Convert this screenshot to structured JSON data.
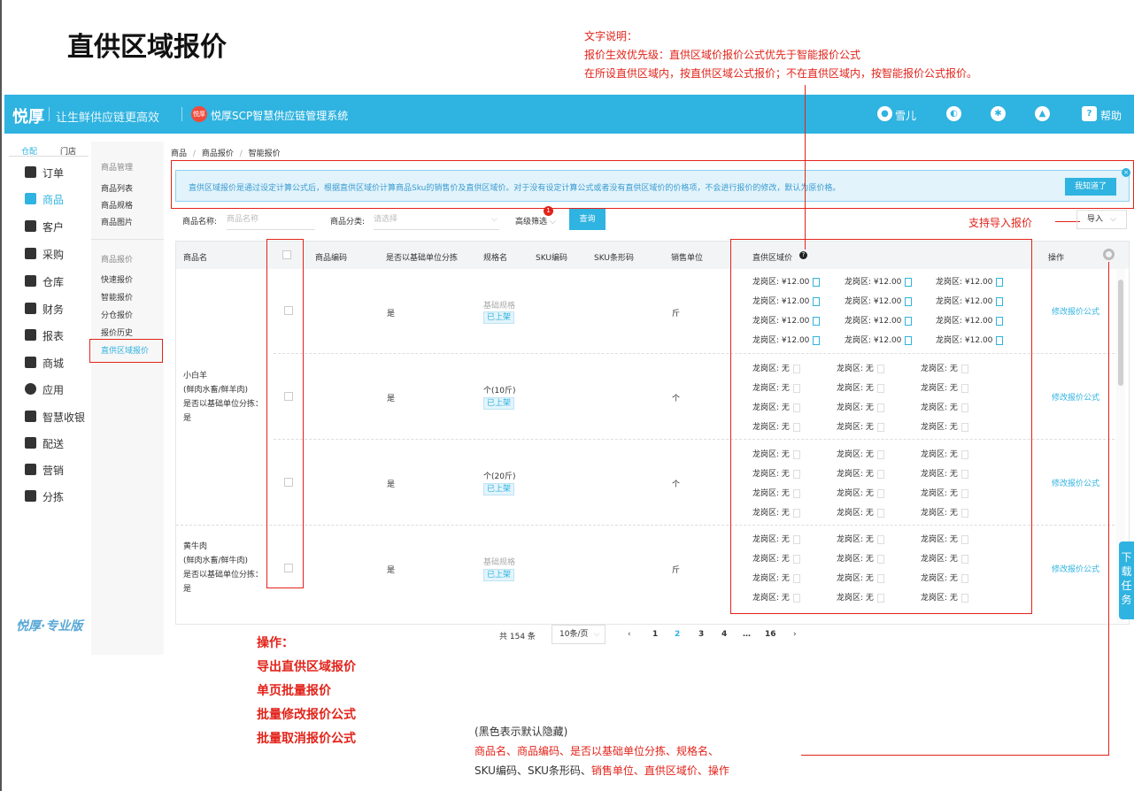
{
  "page_title": "直供区域报价",
  "notes": {
    "title": "文字说明：",
    "line1": "报价生效优先级：直供区域价报价公式优先于智能报价公式",
    "line2": "在所设直供区域内，按直供区域公式报价；不在直供区域内，按智能报价公式报价。",
    "import_note": "支持导入报价",
    "ops_title": "操作：",
    "ops": [
      "导出直供区域报价",
      "单页批量报价",
      "批量修改报价公式",
      "批量取消报价公式"
    ],
    "cols_line1": "(黑色表示默认隐藏)",
    "cols_line2": "商品名、商品编码、是否以基础单位分拣、规格名、",
    "cols_line3a": "SKU编码、SKU条形码、",
    "cols_line3b": "销售单位、直供区域价、操作"
  },
  "topbar": {
    "logo": "悦厚",
    "slogan": "让生鲜供应链更高效",
    "brand_icon": "悦厚",
    "brand_name": "悦厚SCP智慧供应链管理系统",
    "user": "雪儿",
    "help": "帮助"
  },
  "side_tabs": [
    "仓配",
    "门店"
  ],
  "menu": [
    {
      "label": "订单",
      "icon": "order-icon"
    },
    {
      "label": "商品",
      "icon": "goods-icon",
      "active": true
    },
    {
      "label": "客户",
      "icon": "customer-icon"
    },
    {
      "label": "采购",
      "icon": "purchase-icon"
    },
    {
      "label": "仓库",
      "icon": "warehouse-icon"
    },
    {
      "label": "财务",
      "icon": "finance-icon"
    },
    {
      "label": "报表",
      "icon": "report-icon"
    },
    {
      "label": "商城",
      "icon": "mall-icon"
    },
    {
      "label": "应用",
      "icon": "app-icon"
    },
    {
      "label": "智慧收银",
      "icon": "cashier-icon"
    },
    {
      "label": "配送",
      "icon": "delivery-icon"
    },
    {
      "label": "营销",
      "icon": "marketing-icon"
    },
    {
      "label": "分拣",
      "icon": "sorting-icon"
    }
  ],
  "footer_logo": "悦厚·专业版",
  "submenu": {
    "group1": "商品管理",
    "group1_items": [
      "商品列表",
      "商品规格",
      "商品图片"
    ],
    "group2": "商品报价",
    "group2_items": [
      "快速报价",
      "智能报价",
      "分仓报价",
      "报价历史",
      "直供区域报价"
    ]
  },
  "breadcrumb": [
    "商品",
    "/",
    "商品报价",
    "/",
    "智能报价"
  ],
  "alert": {
    "text": "直供区域报价是通过设定计算公式后，根据直供区域价计算商品Sku的销售价及直供区域价。对于没有设定计算公式或者没有直供区域价的价格项，不会进行报价的修改，默认为原价格。",
    "button": "我知道了",
    "close": "×"
  },
  "filters": {
    "name_label": "商品名称:",
    "name_placeholder": "商品名称",
    "category_label": "商品分类:",
    "category_placeholder": "请选择",
    "advanced": "高级筛选",
    "badge": "1",
    "query": "查询",
    "import": "导入"
  },
  "columns": [
    "商品名",
    "商品编码",
    "是否以基础单位分拣",
    "规格名",
    "SKU编码",
    "SKU条形码",
    "销售单位",
    "直供区域价",
    "操作"
  ],
  "products": [
    {
      "name": "小白羊",
      "category": "(鲜肉水畜/鲜羊肉)",
      "basic_label": "是否以基础单位分拣：",
      "basic_value": "是"
    },
    {
      "name": "黄牛肉",
      "category": "(鲜肉水畜/鲜牛肉)",
      "basic_label": "是否以基础单位分拣：",
      "basic_value": "是"
    }
  ],
  "rows": [
    {
      "basic": "是",
      "spec": "基础规格",
      "spec_grey": true,
      "tag": "已上架",
      "unit": "斤",
      "region": "龙岗区:",
      "price": "¥12.00",
      "op": "修改报价公式"
    },
    {
      "basic": "是",
      "spec": "个(10斤)",
      "spec_grey": false,
      "tag": "已上架",
      "unit": "个",
      "region": "龙岗区:",
      "price": "无",
      "op": "修改报价公式"
    },
    {
      "basic": "是",
      "spec": "个(20斤)",
      "spec_grey": false,
      "tag": "已上架",
      "unit": "个",
      "region": "龙岗区:",
      "price": "无",
      "op": "修改报价公式"
    },
    {
      "basic": "是",
      "spec": "基础规格",
      "spec_grey": true,
      "tag": "已上架",
      "unit": "斤",
      "region": "龙岗区:",
      "price": "无",
      "op": "修改报价公式"
    }
  ],
  "pagination": {
    "total": "共 154 条",
    "page_size": "10条/页",
    "prev": "‹",
    "pages": [
      "1",
      "2",
      "3",
      "4",
      "…",
      "16"
    ],
    "current": "2",
    "next": "›"
  },
  "download_tab": "下载任务",
  "colors": {
    "accent": "#2fb3e0",
    "annotation": "#e2231a"
  }
}
